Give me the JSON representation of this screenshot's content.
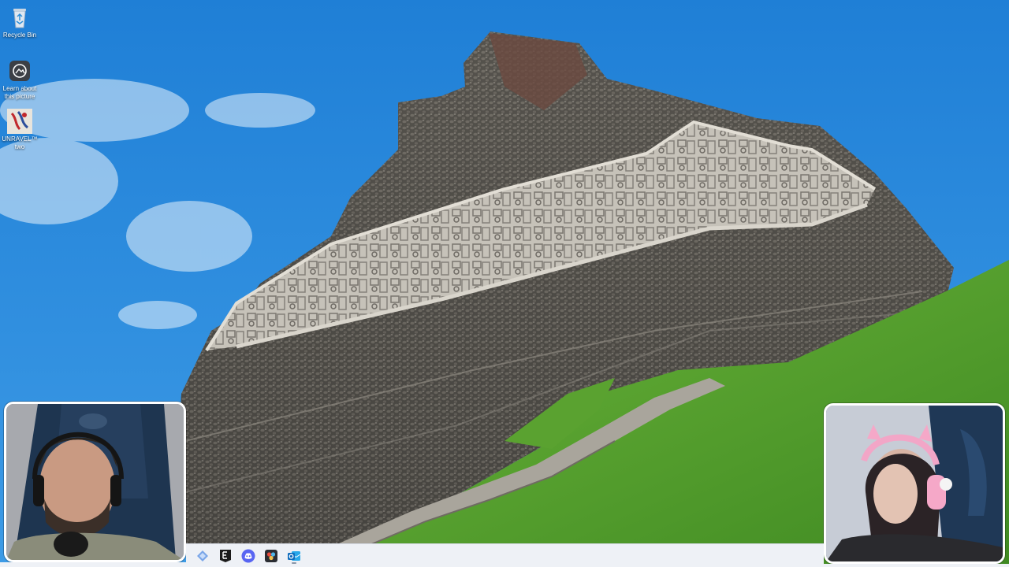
{
  "desktop": {
    "icons": [
      {
        "label": "Recycle Bin",
        "icon": "recycle-bin-icon"
      },
      {
        "label": "Learn about this picture",
        "icon": "learn-about-picture-icon"
      },
      {
        "label": "UNRAVEL™ two",
        "icon": "unravel-two-icon"
      }
    ]
  },
  "wallpaper": {
    "subject": "mayan-temple-xunantunich",
    "colors": {
      "sky": "#2a86d8",
      "grass": "#4f9a2a",
      "stone": "#5c5a55",
      "frieze": "#c9c5bc"
    }
  },
  "webcams": {
    "left": {
      "icon": "webcam-feed-left"
    },
    "right": {
      "icon": "webcam-feed-right"
    }
  },
  "taskbar": {
    "apps": [
      {
        "name": "app-diamond",
        "icon": "diamond-app-icon"
      },
      {
        "name": "app-epic",
        "icon": "epic-games-icon"
      },
      {
        "name": "app-discord",
        "icon": "discord-icon"
      },
      {
        "name": "app-davinci",
        "icon": "davinci-resolve-icon"
      },
      {
        "name": "app-outlook",
        "icon": "outlook-icon"
      }
    ],
    "colors": {
      "bg": "#eef1f6",
      "discord": "#5865f2",
      "outlook": "#0f6cbd"
    }
  }
}
